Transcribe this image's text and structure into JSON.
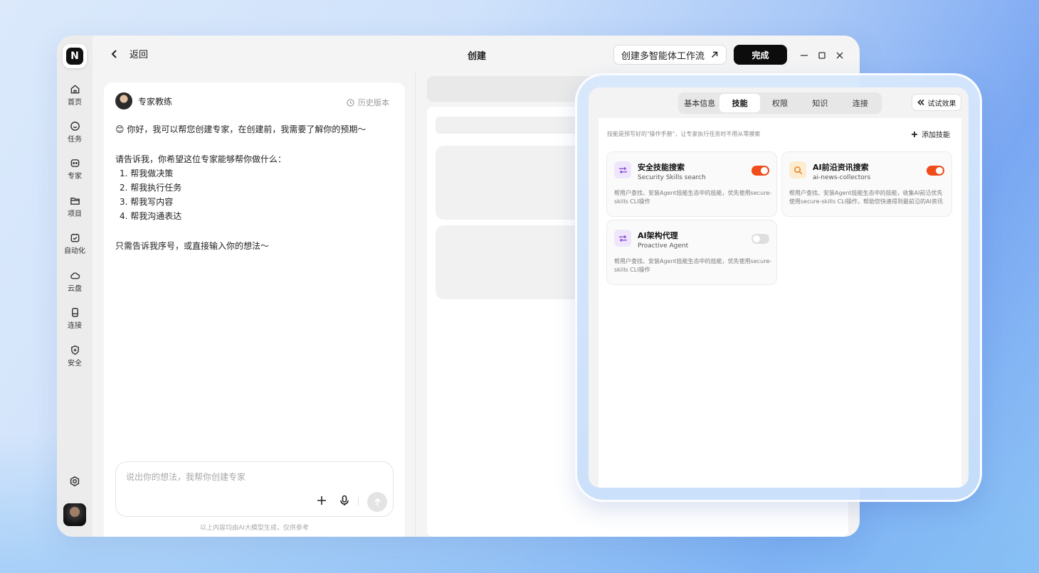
{
  "topbar": {
    "back_label": "返回",
    "title": "创建",
    "flow_button": "创建多智能体工作流",
    "done_button": "完成"
  },
  "sidebar": {
    "logo": "N",
    "items": [
      {
        "label": "首页",
        "icon": "home-icon"
      },
      {
        "label": "任务",
        "icon": "chat-icon"
      },
      {
        "label": "专家",
        "icon": "bot-icon"
      },
      {
        "label": "项目",
        "icon": "folder-icon"
      },
      {
        "label": "自动化",
        "icon": "calendar-check-icon"
      },
      {
        "label": "云盘",
        "icon": "cloud-icon"
      },
      {
        "label": "连接",
        "icon": "device-icon"
      },
      {
        "label": "安全",
        "icon": "shield-icon"
      }
    ]
  },
  "chat": {
    "name": "专家教练",
    "history": "历史版本",
    "greeting": "😊 你好，我可以帮您创建专家，在创建前，我需要了解你的预期～",
    "question": "请告诉我，你希望这位专家能够帮你做什么：",
    "options": [
      "1. 帮我做决策",
      "2. 帮我执行任务",
      "3. 帮我写内容",
      "4. 帮我沟通表达"
    ],
    "closing": "只需告诉我序号，或直接输入你的想法～",
    "input_placeholder": "说出你的想法，我帮你创建专家",
    "disclaimer": "以上内容均由AI大模型生成，仅供参考"
  },
  "skills_panel": {
    "tabs": [
      {
        "label": "基本信息",
        "active": false
      },
      {
        "label": "技能",
        "active": true
      },
      {
        "label": "权限",
        "active": false
      },
      {
        "label": "知识",
        "active": false
      },
      {
        "label": "连接",
        "active": false
      }
    ],
    "try_button": "试试效果",
    "hint": "技能是预写好的\"操作手册\"，让专家执行任务时不用从零摸索",
    "add_button": "添加技能",
    "cards": [
      {
        "title": "安全技能搜索",
        "subtitle": "Security Skills search",
        "description": "帮用户查找、安装Agent技能生态中的技能，优先使用secure-skills CLI操作",
        "enabled": true,
        "icon": "repeat-icon",
        "icon_color": "#8a4fe0",
        "icon_bg": "#efe6fb"
      },
      {
        "title": "AI前沿资讯搜索",
        "subtitle": "ai-news-collectors",
        "description": "帮用户查找、安装Agent技能生态中的技能，收集AI前沿优先使用secure-skills CLI操作，帮助您快速得到最前沿的AI资讯",
        "enabled": true,
        "icon": "search-sparkle-icon",
        "icon_color": "#e07a1a",
        "icon_bg": "#fdeccf"
      },
      {
        "title": "AI架构代理",
        "subtitle": "Proactive Agent",
        "description": "帮用户查找、安装Agent技能生态中的技能，优先使用secure-skills CLI操作",
        "enabled": false,
        "icon": "repeat-icon",
        "icon_color": "#8a4fe0",
        "icon_bg": "#efe6fb"
      }
    ]
  },
  "colors": {
    "accent_toggle": "#f04d1a",
    "done_button_bg": "#0c0c0c"
  }
}
